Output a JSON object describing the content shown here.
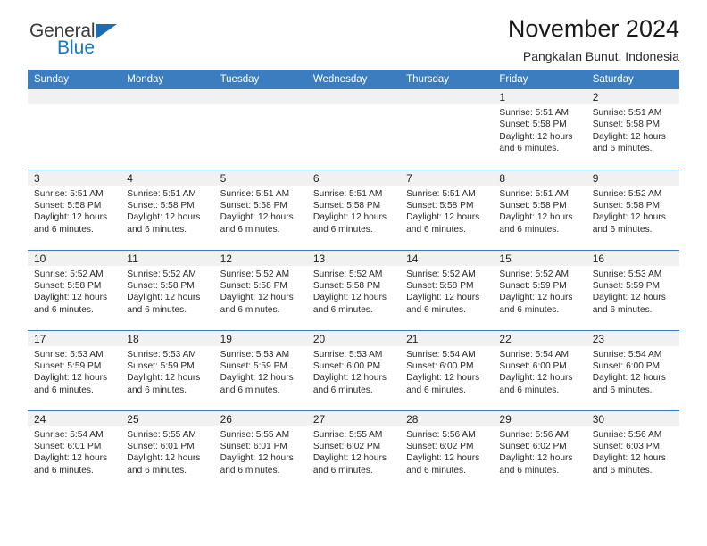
{
  "logo": {
    "word1": "General",
    "word2": "Blue",
    "triangle_color": "#1b6cb0",
    "blue_color": "#1877c4"
  },
  "header": {
    "title": "November 2024",
    "subtitle": "Pangkalan Bunut, Indonesia"
  },
  "theme": {
    "header_bg": "#3b7dbf",
    "header_text": "#ffffff",
    "daynum_band_bg": "#f1f1f1",
    "cell_bg": "#ffffff",
    "row_divider": "#3b7dbf"
  },
  "weekday_headers": [
    "Sunday",
    "Monday",
    "Tuesday",
    "Wednesday",
    "Thursday",
    "Friday",
    "Saturday"
  ],
  "weeks": [
    [
      {
        "day": "",
        "empty": true,
        "sunrise": "",
        "sunset": "",
        "daylight_line1": "",
        "daylight_line2": ""
      },
      {
        "day": "",
        "empty": true,
        "sunrise": "",
        "sunset": "",
        "daylight_line1": "",
        "daylight_line2": ""
      },
      {
        "day": "",
        "empty": true,
        "sunrise": "",
        "sunset": "",
        "daylight_line1": "",
        "daylight_line2": ""
      },
      {
        "day": "",
        "empty": true,
        "sunrise": "",
        "sunset": "",
        "daylight_line1": "",
        "daylight_line2": ""
      },
      {
        "day": "",
        "empty": true,
        "sunrise": "",
        "sunset": "",
        "daylight_line1": "",
        "daylight_line2": ""
      },
      {
        "day": "1",
        "empty": false,
        "sunrise": "Sunrise: 5:51 AM",
        "sunset": "Sunset: 5:58 PM",
        "daylight_line1": "Daylight: 12 hours",
        "daylight_line2": "and 6 minutes."
      },
      {
        "day": "2",
        "empty": false,
        "sunrise": "Sunrise: 5:51 AM",
        "sunset": "Sunset: 5:58 PM",
        "daylight_line1": "Daylight: 12 hours",
        "daylight_line2": "and 6 minutes."
      }
    ],
    [
      {
        "day": "3",
        "empty": false,
        "sunrise": "Sunrise: 5:51 AM",
        "sunset": "Sunset: 5:58 PM",
        "daylight_line1": "Daylight: 12 hours",
        "daylight_line2": "and 6 minutes."
      },
      {
        "day": "4",
        "empty": false,
        "sunrise": "Sunrise: 5:51 AM",
        "sunset": "Sunset: 5:58 PM",
        "daylight_line1": "Daylight: 12 hours",
        "daylight_line2": "and 6 minutes."
      },
      {
        "day": "5",
        "empty": false,
        "sunrise": "Sunrise: 5:51 AM",
        "sunset": "Sunset: 5:58 PM",
        "daylight_line1": "Daylight: 12 hours",
        "daylight_line2": "and 6 minutes."
      },
      {
        "day": "6",
        "empty": false,
        "sunrise": "Sunrise: 5:51 AM",
        "sunset": "Sunset: 5:58 PM",
        "daylight_line1": "Daylight: 12 hours",
        "daylight_line2": "and 6 minutes."
      },
      {
        "day": "7",
        "empty": false,
        "sunrise": "Sunrise: 5:51 AM",
        "sunset": "Sunset: 5:58 PM",
        "daylight_line1": "Daylight: 12 hours",
        "daylight_line2": "and 6 minutes."
      },
      {
        "day": "8",
        "empty": false,
        "sunrise": "Sunrise: 5:51 AM",
        "sunset": "Sunset: 5:58 PM",
        "daylight_line1": "Daylight: 12 hours",
        "daylight_line2": "and 6 minutes."
      },
      {
        "day": "9",
        "empty": false,
        "sunrise": "Sunrise: 5:52 AM",
        "sunset": "Sunset: 5:58 PM",
        "daylight_line1": "Daylight: 12 hours",
        "daylight_line2": "and 6 minutes."
      }
    ],
    [
      {
        "day": "10",
        "empty": false,
        "sunrise": "Sunrise: 5:52 AM",
        "sunset": "Sunset: 5:58 PM",
        "daylight_line1": "Daylight: 12 hours",
        "daylight_line2": "and 6 minutes."
      },
      {
        "day": "11",
        "empty": false,
        "sunrise": "Sunrise: 5:52 AM",
        "sunset": "Sunset: 5:58 PM",
        "daylight_line1": "Daylight: 12 hours",
        "daylight_line2": "and 6 minutes."
      },
      {
        "day": "12",
        "empty": false,
        "sunrise": "Sunrise: 5:52 AM",
        "sunset": "Sunset: 5:58 PM",
        "daylight_line1": "Daylight: 12 hours",
        "daylight_line2": "and 6 minutes."
      },
      {
        "day": "13",
        "empty": false,
        "sunrise": "Sunrise: 5:52 AM",
        "sunset": "Sunset: 5:58 PM",
        "daylight_line1": "Daylight: 12 hours",
        "daylight_line2": "and 6 minutes."
      },
      {
        "day": "14",
        "empty": false,
        "sunrise": "Sunrise: 5:52 AM",
        "sunset": "Sunset: 5:58 PM",
        "daylight_line1": "Daylight: 12 hours",
        "daylight_line2": "and 6 minutes."
      },
      {
        "day": "15",
        "empty": false,
        "sunrise": "Sunrise: 5:52 AM",
        "sunset": "Sunset: 5:59 PM",
        "daylight_line1": "Daylight: 12 hours",
        "daylight_line2": "and 6 minutes."
      },
      {
        "day": "16",
        "empty": false,
        "sunrise": "Sunrise: 5:53 AM",
        "sunset": "Sunset: 5:59 PM",
        "daylight_line1": "Daylight: 12 hours",
        "daylight_line2": "and 6 minutes."
      }
    ],
    [
      {
        "day": "17",
        "empty": false,
        "sunrise": "Sunrise: 5:53 AM",
        "sunset": "Sunset: 5:59 PM",
        "daylight_line1": "Daylight: 12 hours",
        "daylight_line2": "and 6 minutes."
      },
      {
        "day": "18",
        "empty": false,
        "sunrise": "Sunrise: 5:53 AM",
        "sunset": "Sunset: 5:59 PM",
        "daylight_line1": "Daylight: 12 hours",
        "daylight_line2": "and 6 minutes."
      },
      {
        "day": "19",
        "empty": false,
        "sunrise": "Sunrise: 5:53 AM",
        "sunset": "Sunset: 5:59 PM",
        "daylight_line1": "Daylight: 12 hours",
        "daylight_line2": "and 6 minutes."
      },
      {
        "day": "20",
        "empty": false,
        "sunrise": "Sunrise: 5:53 AM",
        "sunset": "Sunset: 6:00 PM",
        "daylight_line1": "Daylight: 12 hours",
        "daylight_line2": "and 6 minutes."
      },
      {
        "day": "21",
        "empty": false,
        "sunrise": "Sunrise: 5:54 AM",
        "sunset": "Sunset: 6:00 PM",
        "daylight_line1": "Daylight: 12 hours",
        "daylight_line2": "and 6 minutes."
      },
      {
        "day": "22",
        "empty": false,
        "sunrise": "Sunrise: 5:54 AM",
        "sunset": "Sunset: 6:00 PM",
        "daylight_line1": "Daylight: 12 hours",
        "daylight_line2": "and 6 minutes."
      },
      {
        "day": "23",
        "empty": false,
        "sunrise": "Sunrise: 5:54 AM",
        "sunset": "Sunset: 6:00 PM",
        "daylight_line1": "Daylight: 12 hours",
        "daylight_line2": "and 6 minutes."
      }
    ],
    [
      {
        "day": "24",
        "empty": false,
        "sunrise": "Sunrise: 5:54 AM",
        "sunset": "Sunset: 6:01 PM",
        "daylight_line1": "Daylight: 12 hours",
        "daylight_line2": "and 6 minutes."
      },
      {
        "day": "25",
        "empty": false,
        "sunrise": "Sunrise: 5:55 AM",
        "sunset": "Sunset: 6:01 PM",
        "daylight_line1": "Daylight: 12 hours",
        "daylight_line2": "and 6 minutes."
      },
      {
        "day": "26",
        "empty": false,
        "sunrise": "Sunrise: 5:55 AM",
        "sunset": "Sunset: 6:01 PM",
        "daylight_line1": "Daylight: 12 hours",
        "daylight_line2": "and 6 minutes."
      },
      {
        "day": "27",
        "empty": false,
        "sunrise": "Sunrise: 5:55 AM",
        "sunset": "Sunset: 6:02 PM",
        "daylight_line1": "Daylight: 12 hours",
        "daylight_line2": "and 6 minutes."
      },
      {
        "day": "28",
        "empty": false,
        "sunrise": "Sunrise: 5:56 AM",
        "sunset": "Sunset: 6:02 PM",
        "daylight_line1": "Daylight: 12 hours",
        "daylight_line2": "and 6 minutes."
      },
      {
        "day": "29",
        "empty": false,
        "sunrise": "Sunrise: 5:56 AM",
        "sunset": "Sunset: 6:02 PM",
        "daylight_line1": "Daylight: 12 hours",
        "daylight_line2": "and 6 minutes."
      },
      {
        "day": "30",
        "empty": false,
        "sunrise": "Sunrise: 5:56 AM",
        "sunset": "Sunset: 6:03 PM",
        "daylight_line1": "Daylight: 12 hours",
        "daylight_line2": "and 6 minutes."
      }
    ]
  ]
}
